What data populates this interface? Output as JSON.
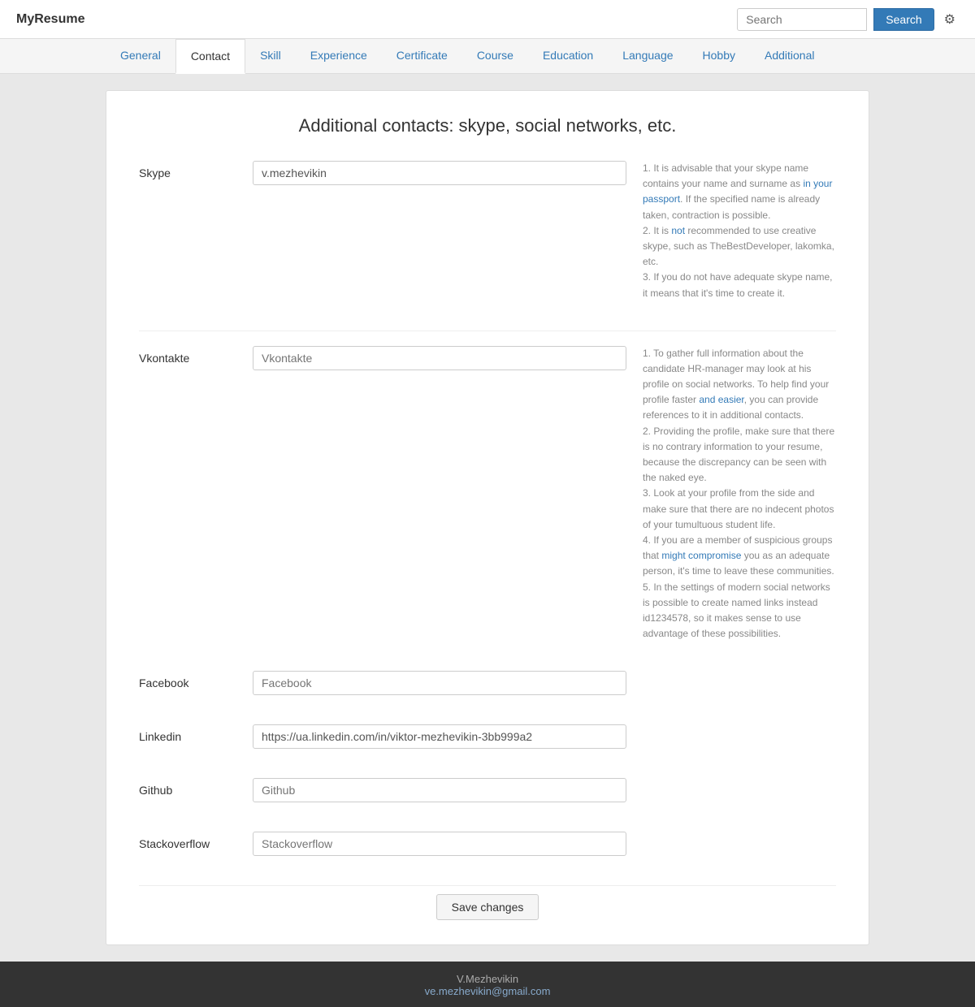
{
  "header": {
    "brand": "MyResume",
    "search_placeholder": "Search",
    "search_button": "Search",
    "gear_icon": "⚙"
  },
  "nav": {
    "tabs": [
      {
        "label": "General",
        "active": false
      },
      {
        "label": "Contact",
        "active": true
      },
      {
        "label": "Skill",
        "active": false
      },
      {
        "label": "Experience",
        "active": false
      },
      {
        "label": "Certificate",
        "active": false
      },
      {
        "label": "Course",
        "active": false
      },
      {
        "label": "Education",
        "active": false
      },
      {
        "label": "Language",
        "active": false
      },
      {
        "label": "Hobby",
        "active": false
      },
      {
        "label": "Additional",
        "active": false
      }
    ]
  },
  "page": {
    "title": "Additional contacts: skype, social networks, etc.",
    "fields": [
      {
        "label": "Skype",
        "name": "skype",
        "value": "v.mezhevikin",
        "placeholder": ""
      },
      {
        "label": "Vkontakte",
        "name": "vkontakte",
        "value": "",
        "placeholder": "Vkontakte"
      },
      {
        "label": "Facebook",
        "name": "facebook",
        "value": "",
        "placeholder": "Facebook"
      },
      {
        "label": "Linkedin",
        "name": "linkedin",
        "value": "https://ua.linkedin.com/in/viktor-mezhevikin-3bb999a2",
        "placeholder": ""
      },
      {
        "label": "Github",
        "name": "github",
        "value": "",
        "placeholder": "Github"
      },
      {
        "label": "Stackoverflow",
        "name": "stackoverflow",
        "value": "",
        "placeholder": "Stackoverflow"
      }
    ],
    "hint_skype": {
      "lines": [
        "1. It is advisable that your skype name contains your name and surname as in your passport. If the specified name is already taken, contraction is possible.",
        "2. It is not recommended to use creative skype, such as TheBestDeveloper, lakomka, etc.",
        "3. If you do not have adequate skype name, it means that it's time to create it."
      ]
    },
    "hint_social": {
      "lines": [
        "1. To gather full information about the candidate HR-manager may look at his profile on social networks. To help find your profile faster and easier, you can provide references to it in additional contacts.",
        "2. Providing the profile, make sure that there is no contrary information to your resume, because the discrepancy can be seen with the naked eye.",
        "3. Look at your profile from the side and make sure that there are no indecent photos of your tumultuous student life.",
        "4. If you are a member of suspicious groups that might compromise you as an adequate person, it's time to leave these communities.",
        "5. In the settings of modern social networks is possible to create named links instead id1234578, so it makes sense to use advantage of these possibilities."
      ]
    },
    "save_button": "Save changes"
  },
  "footer": {
    "name": "V.Mezhevikin",
    "email": "ve.mezhevikin@gmail.com"
  }
}
